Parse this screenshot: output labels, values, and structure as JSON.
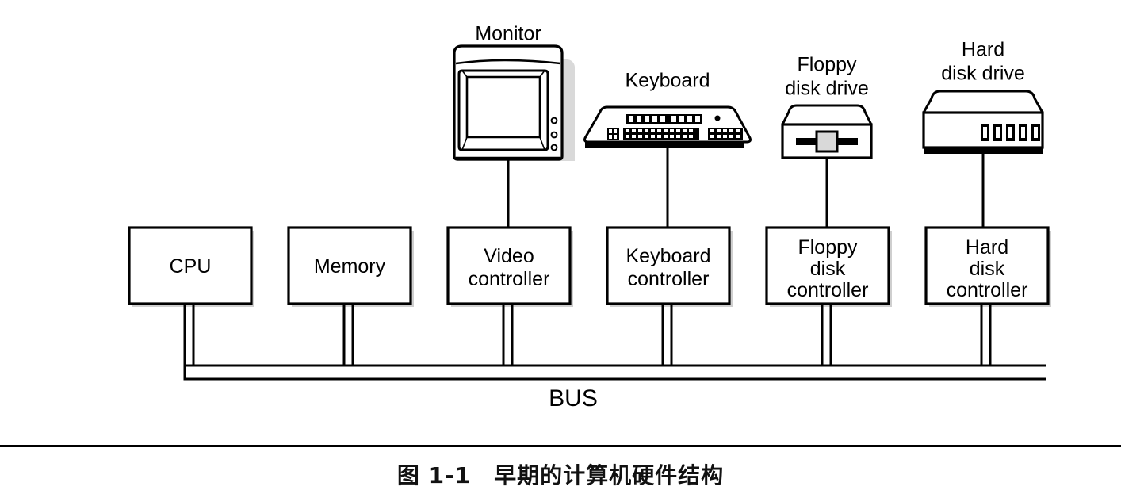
{
  "figure": {
    "caption": "图 1-1　早期的计算机硬件结构",
    "bus_label": "BUS"
  },
  "devices": [
    {
      "id": "monitor",
      "label": "Monitor",
      "label_lines": [
        "Monitor"
      ],
      "icon": "crt-monitor-icon"
    },
    {
      "id": "keyboard",
      "label": "Keyboard",
      "label_lines": [
        "Keyboard"
      ],
      "icon": "keyboard-icon"
    },
    {
      "id": "floppy",
      "label": "Floppy disk drive",
      "label_lines": [
        "Floppy",
        "disk drive"
      ],
      "icon": "floppy-disk-drive-icon"
    },
    {
      "id": "harddisk",
      "label": "Hard disk drive",
      "label_lines": [
        "Hard",
        "disk drive"
      ],
      "icon": "hard-disk-drive-icon"
    }
  ],
  "boxes": [
    {
      "id": "cpu",
      "label": "CPU",
      "lines": [
        "CPU"
      ]
    },
    {
      "id": "memory",
      "label": "Memory",
      "lines": [
        "Memory"
      ]
    },
    {
      "id": "video-controller",
      "label": "Video controller",
      "lines": [
        "Video",
        "controller"
      ]
    },
    {
      "id": "keyboard-controller",
      "label": "Keyboard controller",
      "lines": [
        "Keyboard",
        "controller"
      ]
    },
    {
      "id": "floppy-controller",
      "label": "Floppy disk controller",
      "lines": [
        "Floppy",
        "disk",
        "controller"
      ]
    },
    {
      "id": "harddisk-controller",
      "label": "Hard disk controller",
      "lines": [
        "Hard",
        "disk",
        "controller"
      ]
    }
  ],
  "colors": {
    "line": "#000000",
    "fill": "#ffffff",
    "shadow": "#cccccc",
    "text": "#000000"
  }
}
